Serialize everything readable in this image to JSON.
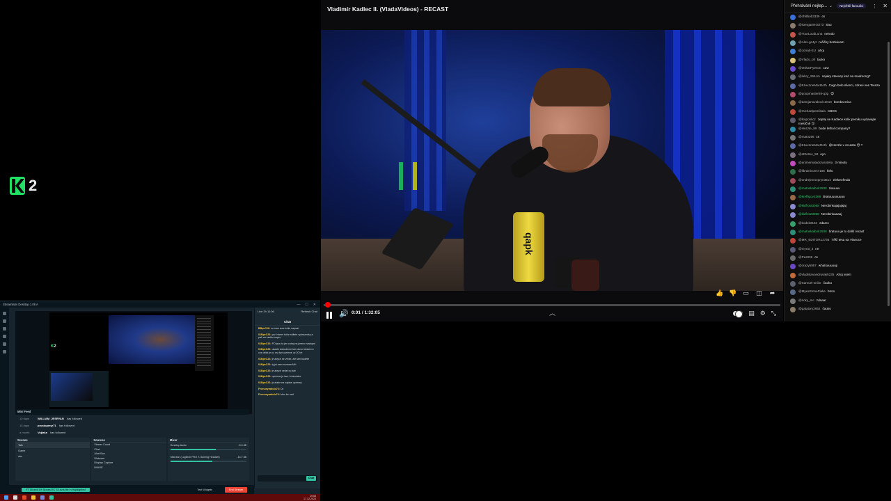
{
  "logo": {
    "text": "2"
  },
  "video": {
    "title": "Vladimír Kadlec II. (VladaVideos) - RECAST",
    "progress_fraction": 0.0005,
    "time_current": "0:01",
    "time_separator": " / ",
    "time_total": "1:32:05",
    "can_text": "qapk"
  },
  "chat": {
    "header_label": "Přehrávání nejlep...",
    "badge": "Největší fanoušci",
    "messages": [
      {
        "user": "@chillbob3339",
        "text": "cs",
        "color": "#3a6fd8",
        "mod": false
      },
      {
        "user": "@isengamer3273",
        "text": "Sau",
        "color": "#8a7a70",
        "mod": false
      },
      {
        "user": "@YourLoudLuna",
        "text": "neroob",
        "color": "#c5554b",
        "mod": false
      },
      {
        "user": "@Alex-gc4yt",
        "text": "ručičky bozkávam",
        "color": "#6fa3b2",
        "mod": false
      },
      {
        "user": "@Jona5-EU",
        "text": "ahoj",
        "color": "#3f7fd6",
        "mod": false
      },
      {
        "user": "@Vlado_ofi",
        "text": "tauko",
        "color": "#d9c27a",
        "mod": false
      },
      {
        "user": "@OskarPytrson",
        "text": "caw",
        "color": "#6a4ad0",
        "mod": false
      },
      {
        "user": "@lukry_264cm",
        "text": "nejaky steevey kod na madmong?",
        "color": "#6a6f78",
        "mod": false
      },
      {
        "user": "@81ux1neMacRoth",
        "text": "Cago belo silenci, zdravi vas Tereza",
        "color": "#5d6aa6",
        "mod": false
      },
      {
        "user": "@poopmaster69-q3g",
        "text": "😍",
        "color": "#b34a6a",
        "mod": false
      },
      {
        "user": "@damjanovakovic2018",
        "text": "bomba srica",
        "color": "#8b6a4c",
        "mod": false
      },
      {
        "user": "@michaelpomikala",
        "text": "CBOS",
        "color": "#c24a3a",
        "mod": false
      },
      {
        "user": "@lkupoolicz",
        "text": "zeptej se Kadlece kolik pemiku vydavajte mesíčně 😗",
        "color": "#5c5c6c",
        "mod": false
      },
      {
        "user": "@Hezzle_99",
        "text": "bude lethal company?",
        "color": "#2e8ba8",
        "mod": false
      },
      {
        "user": "@mato296",
        "text": "cs",
        "color": "#777",
        "mod": false
      },
      {
        "user": "@81ux1neMacRoth",
        "text": "@Hezzle v recasta 😯 ?",
        "color": "#5d6aa6",
        "mod": false
      },
      {
        "user": "@st3v3ee_58",
        "text": "eyo",
        "color": "#7a7080",
        "mod": false
      },
      {
        "user": "@animematadoraruteka",
        "text": "3 minuty",
        "color": "#c44ac0",
        "mod": false
      },
      {
        "user": "@llbrainicons7106",
        "text": "helo",
        "color": "#2f6e4a",
        "mod": false
      },
      {
        "user": "@ondrejmrozpryn3514",
        "text": "elektrofrnda",
        "color": "#a04a5a",
        "mod": false
      },
      {
        "user": "@matoskaibok2938",
        "text": "ziauuuu",
        "color": "#2d8e7a",
        "mod": true
      },
      {
        "user": "@kreffigov2368",
        "text": "Bratuuuuuuuuu",
        "color": "#9a6a4a",
        "mod": true
      },
      {
        "user": "@kidfrost3068",
        "text": "Nerobinkajajajajaj",
        "color": "#8a8ad0",
        "mod": true
      },
      {
        "user": "@kidfrost3068",
        "text": "Nerobinkaaaaj",
        "color": "#8a8ad0",
        "mod": true
      },
      {
        "user": "@kodek3134",
        "text": "zdarec",
        "color": "#35a06a",
        "mod": false
      },
      {
        "user": "@matoskaibok2938",
        "text": "bratuuu je tu ďalší recast",
        "color": "#2d8e7a",
        "mod": true
      },
      {
        "user": "@MR_EDITOR12736",
        "text": "Těší tesa na Vianoce",
        "color": "#c2443a",
        "mod": false
      },
      {
        "user": "@myrat_3",
        "text": "ne",
        "color": "#5a5a78",
        "mod": false
      },
      {
        "user": "@Pes009",
        "text": "cs",
        "color": "#6a6a6a",
        "mod": false
      },
      {
        "user": "@crazy5957",
        "text": "whatsuuuuup",
        "color": "#6b48c4",
        "mod": false
      },
      {
        "user": "@vladislavandrusak5235",
        "text": "Ahoj vsem",
        "color": "#c26a3a",
        "mod": false
      },
      {
        "user": "@Samuel-sniior",
        "text": "čauko",
        "color": "#5c6070",
        "mod": false
      },
      {
        "user": "@MyesStoneFlake",
        "text": "hmm",
        "color": "#5a6a86",
        "mod": false
      },
      {
        "user": "@ricky_mc",
        "text": "zdaaar",
        "color": "#7a7a7a",
        "mod": false
      },
      {
        "user": "@gatatory2652",
        "text": "čauko",
        "color": "#8a7a6a",
        "mod": false
      }
    ]
  },
  "streamlabs": {
    "title": "Streamlabs Desktop 1.06 A",
    "mini_feed_label": "Mini Feed",
    "feed": [
      {
        "ago": "10 days",
        "who": "WILLIAM_JESRYAN",
        "what": "has followed"
      },
      {
        "ago": "15 days",
        "who": "prostopmyr71",
        "what": "has followed"
      },
      {
        "ago": "a month",
        "who": "Vojtaks",
        "what": "has followed"
      }
    ],
    "scenes_label": "Scenes",
    "scenes": [
      "Talk",
      "Game",
      "dsc"
    ],
    "sources_label": "Sources",
    "sources": [
      "Viewer Count",
      "Chat",
      "Alert Box",
      "Webcam",
      "Display Capture",
      "IMAGE"
    ],
    "mixer_label": "Mixer",
    "mixer": [
      {
        "name": "Desktop Audio",
        "db": "-5.0 dB",
        "level": 0.6
      },
      {
        "name": "Mikrofon (Logitech PRO X Gaming Headset)",
        "db": "-14.7 dB",
        "level": 0.55
      }
    ],
    "chat_top": "Live 2h 11:06",
    "chat_title": "Chat",
    "chat_refresh": "Refresh Chat",
    "chat_messages": [
      {
        "u": "BBpeC26:",
        "t": "co vam sme tohle napsal"
      },
      {
        "u": "01BpeC26:",
        "t": "pa ti stene tuhle sdilete vyhrazenky a pak na vsetko super"
      },
      {
        "u": "01BpeC26:",
        "t": "PO jsou ta jen cokaj na jmeno nastupni"
      },
      {
        "u": "01BpeC26:",
        "t": "ukazte dobudeme tam dovol dostan a cos delat je uz ma byt uprimne uz 20 let"
      },
      {
        "u": "01BpeC26:",
        "t": "je abych se vedel, ale tam budete"
      },
      {
        "u": "01BpeC26:",
        "t": "ty jsi rano rozmne MH"
      },
      {
        "u": "01BpeC26:",
        "t": "je abych vedel co jste"
      },
      {
        "u": "01BpeC26:",
        "t": "uprimne je tam i chemicke"
      },
      {
        "u": "01BpeC26:",
        "t": "ja alade na najake uprimny"
      },
      {
        "u": "Fhenusyradulo76:",
        "t": "Dz"
      },
      {
        "u": "Fhenusyradulo76:",
        "t": "Mno ke nad"
      }
    ],
    "chat_input_placeholder": "Send a message",
    "chat_send": "Chat",
    "status_text": "FT 18 and 1% Spoes-RC 33 avia tile in Highlighted",
    "test_widgets": "Test Widgets",
    "go_live": "End Stream"
  },
  "taskbar": {
    "time": "19:06",
    "date": "17.12.2023"
  }
}
